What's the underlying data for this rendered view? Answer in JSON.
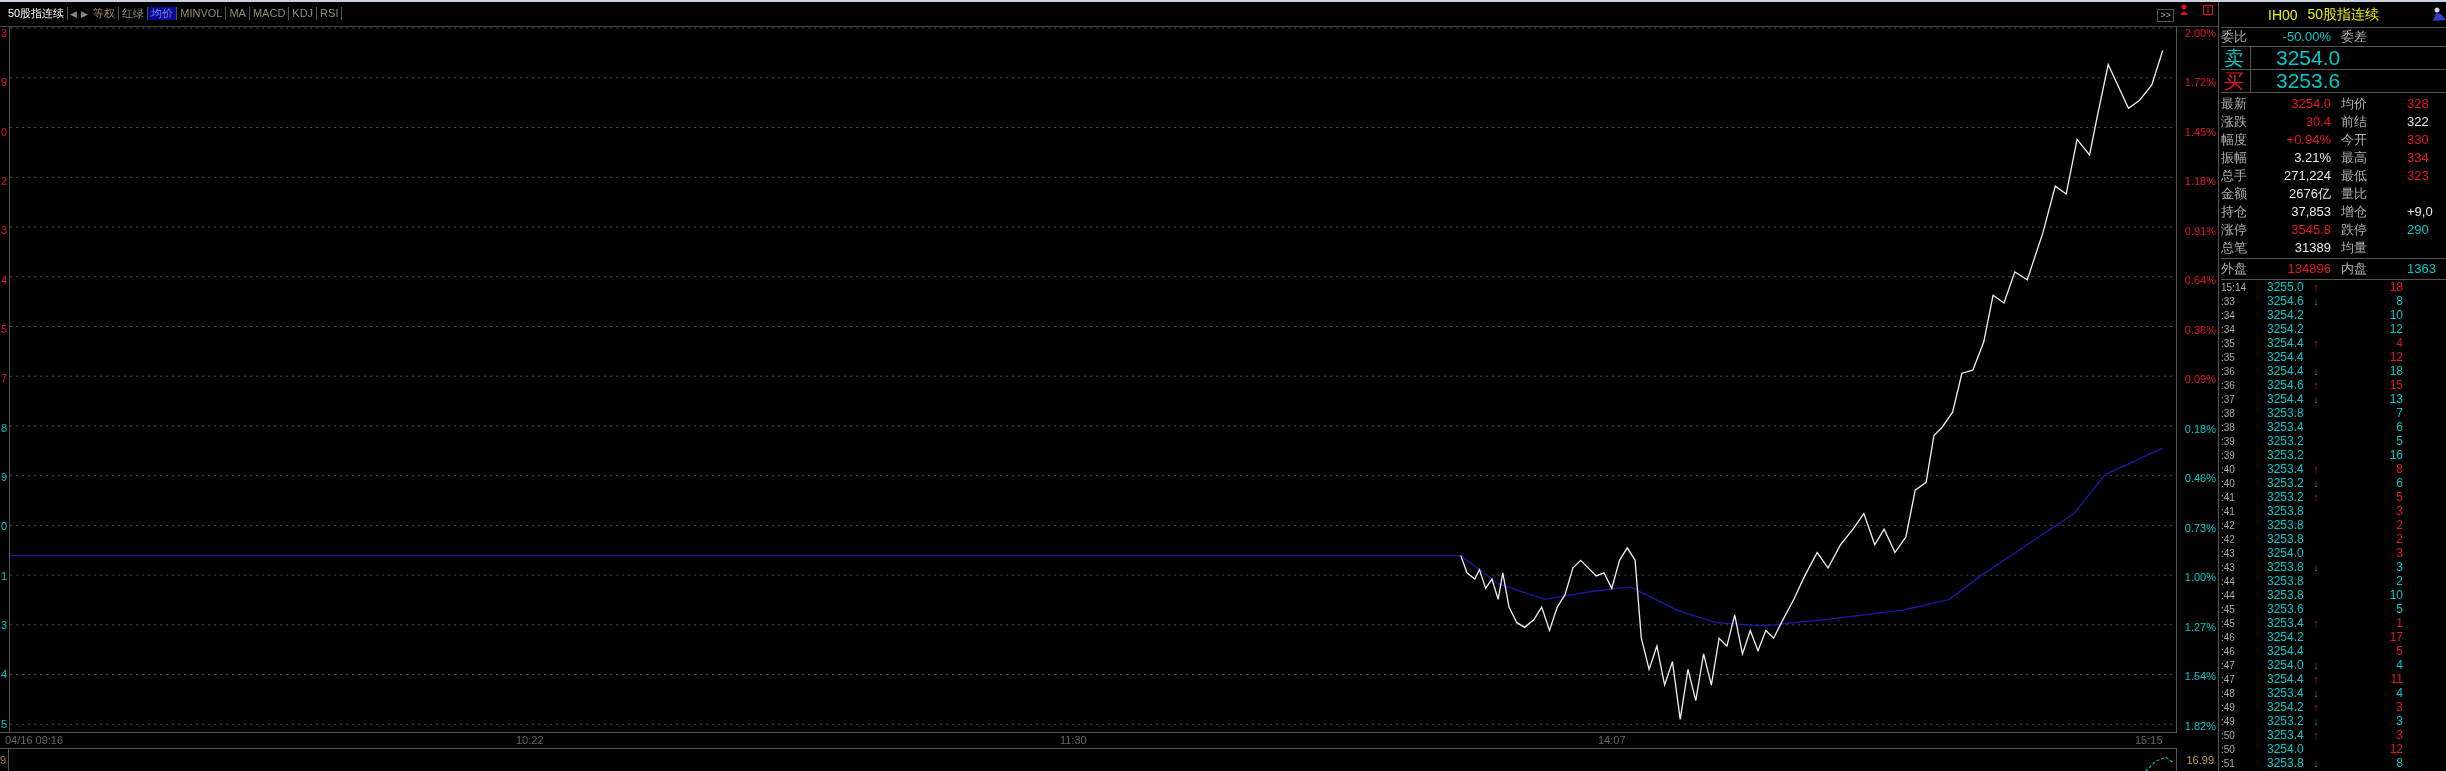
{
  "toolbar": {
    "title": "50股指连续",
    "nav": [
      "◀",
      "▶"
    ],
    "items": [
      {
        "label": "等权",
        "selected": false
      },
      {
        "label": "红绿",
        "selected": false
      },
      {
        "label": "均价",
        "selected": true
      },
      {
        "label": "MINVOL",
        "selected": false
      },
      {
        "label": "MA",
        "selected": false
      },
      {
        "label": "MACD",
        "selected": false
      },
      {
        "label": "KDJ",
        "selected": false
      },
      {
        "label": "RSI",
        "selected": false
      }
    ]
  },
  "chart": {
    "expand_button": ">>",
    "left_axis": [
      {
        "text": "3",
        "kind": "rise"
      },
      {
        "text": "9",
        "kind": "rise"
      },
      {
        "text": "0",
        "kind": "rise"
      },
      {
        "text": "2",
        "kind": "rise"
      },
      {
        "text": "3",
        "kind": "rise"
      },
      {
        "text": "4",
        "kind": "rise"
      },
      {
        "text": "5",
        "kind": "rise"
      },
      {
        "text": "7",
        "kind": "rise"
      },
      {
        "text": "8",
        "kind": "fall"
      },
      {
        "text": "9",
        "kind": "fall"
      },
      {
        "text": "0",
        "kind": "fall"
      },
      {
        "text": "1",
        "kind": "fall"
      },
      {
        "text": "3",
        "kind": "fall"
      },
      {
        "text": "4",
        "kind": "fall"
      },
      {
        "text": "5",
        "kind": "fall"
      }
    ],
    "right_axis": [
      {
        "text": "2.00%",
        "kind": "rise"
      },
      {
        "text": "1.72%",
        "kind": "rise"
      },
      {
        "text": "1.45%",
        "kind": "rise"
      },
      {
        "text": "1.18%",
        "kind": "rise"
      },
      {
        "text": "0.91%",
        "kind": "rise"
      },
      {
        "text": "0.64%",
        "kind": "rise"
      },
      {
        "text": "0.36%",
        "kind": "rise"
      },
      {
        "text": "0.09%",
        "kind": "rise"
      },
      {
        "text": "0.18%",
        "kind": "fall"
      },
      {
        "text": "0.46%",
        "kind": "fall"
      },
      {
        "text": "0.73%",
        "kind": "fall"
      },
      {
        "text": "1.00%",
        "kind": "fall"
      },
      {
        "text": "1.27%",
        "kind": "fall"
      },
      {
        "text": "1.54%",
        "kind": "fall"
      },
      {
        "text": "1.82%",
        "kind": "fall"
      }
    ],
    "time_labels": [
      "04/16 09:16",
      "10:22",
      "11:30",
      "14:07",
      "15:15"
    ],
    "lower_pane": {
      "left_label": "9",
      "right_label": "16.99"
    }
  },
  "panel": {
    "code": "IH00",
    "name": "50股指连续",
    "ratio": {
      "label": "委比",
      "value": "-50.00%",
      "label2": "委差"
    },
    "quotes": [
      {
        "label": "卖",
        "color": "#00c8c8",
        "price": "3254.0"
      },
      {
        "label": "买",
        "color": "#e0182a",
        "price": "3253.6"
      }
    ],
    "stats": [
      {
        "left": {
          "label": "最新",
          "value": "3254.0",
          "kind": "rise"
        },
        "right": {
          "label": "均价",
          "value": "328",
          "kind": "rise"
        }
      },
      {
        "left": {
          "label": "涨跌",
          "value": "30.4",
          "kind": "rise"
        },
        "right": {
          "label": "前结",
          "value": "322",
          "kind": "flat"
        }
      },
      {
        "left": {
          "label": "幅度",
          "value": "+0.94%",
          "kind": "rise"
        },
        "right": {
          "label": "今开",
          "value": "330",
          "kind": "rise"
        }
      },
      {
        "left": {
          "label": "振幅",
          "value": "3.21%",
          "kind": "flat"
        },
        "right": {
          "label": "最高",
          "value": "334",
          "kind": "rise"
        }
      },
      {
        "left": {
          "label": "总手",
          "value": "271,224",
          "kind": "flat"
        },
        "right": {
          "label": "最低",
          "value": "323",
          "kind": "rise"
        }
      },
      {
        "left": {
          "label": "金额",
          "value": "2676亿",
          "kind": "flat"
        },
        "right": {
          "label": "量比"
        }
      },
      {
        "left": {
          "label": "持仓",
          "value": "37,853",
          "kind": "flat"
        },
        "right": {
          "label": "增仓",
          "value": "+9,0",
          "kind": "flat"
        }
      },
      {
        "left": {
          "label": "涨停",
          "value": "3545.8",
          "kind": "rise"
        },
        "right": {
          "label": "跌停",
          "value": "290",
          "kind": "fall"
        }
      },
      {
        "left": {
          "label": "总笔",
          "value": "31389",
          "kind": "flat"
        },
        "right": {
          "label": "均量"
        }
      }
    ],
    "outer": {
      "label": "外盘",
      "value": "134896",
      "label2": "内盘",
      "value2": "1363"
    },
    "ticks": [
      {
        "time": "15:14",
        "price": "3255.0",
        "arrow": {
          "glyph": "↑",
          "kind": "up"
        },
        "volume": "18",
        "color": "#e0182a"
      },
      {
        "time": ":33",
        "price": "3254.6",
        "arrow": {
          "glyph": "↓",
          "kind": "down"
        },
        "volume": "8",
        "color": "#00c8c8"
      },
      {
        "time": ":34",
        "price": "3254.2",
        "volume": "10",
        "color": "#00c8c8"
      },
      {
        "time": ":34",
        "price": "3254.2",
        "volume": "12",
        "color": "#00c8c8"
      },
      {
        "time": ":35",
        "price": "3254.4",
        "arrow": {
          "glyph": "↑",
          "kind": "up"
        },
        "volume": "4",
        "color": "#e0182a"
      },
      {
        "time": ":35",
        "price": "3254.4",
        "volume": "12",
        "color": "#e0182a"
      },
      {
        "time": ":36",
        "price": "3254.4",
        "arrow": {
          "glyph": "↓",
          "kind": "down"
        },
        "volume": "18",
        "color": "#00c8c8"
      },
      {
        "time": ":36",
        "price": "3254.6",
        "arrow": {
          "glyph": "↑",
          "kind": "up"
        },
        "volume": "15",
        "color": "#e0182a"
      },
      {
        "time": ":37",
        "price": "3254.4",
        "arrow": {
          "glyph": "↓",
          "kind": "down"
        },
        "volume": "13",
        "color": "#00c8c8"
      },
      {
        "time": ":38",
        "price": "3253.8",
        "volume": "7",
        "color": "#00c8c8"
      },
      {
        "time": ":38",
        "price": "3253.4",
        "volume": "6",
        "color": "#00c8c8"
      },
      {
        "time": ":39",
        "price": "3253.2",
        "volume": "5",
        "color": "#00c8c8"
      },
      {
        "time": ":39",
        "price": "3253.2",
        "volume": "16",
        "color": "#00c8c8"
      },
      {
        "time": ":40",
        "price": "3253.4",
        "arrow": {
          "glyph": "↑",
          "kind": "up"
        },
        "volume": "8",
        "color": "#e0182a"
      },
      {
        "time": ":40",
        "price": "3253.2",
        "arrow": {
          "glyph": "↓",
          "kind": "down"
        },
        "volume": "6",
        "color": "#00c8c8"
      },
      {
        "time": ":41",
        "price": "3253.2",
        "arrow": {
          "glyph": "↑",
          "kind": "up"
        },
        "volume": "5",
        "color": "#e0182a"
      },
      {
        "time": ":41",
        "price": "3253.8",
        "volume": "3",
        "color": "#e0182a"
      },
      {
        "time": ":42",
        "price": "3253.8",
        "volume": "2",
        "color": "#e0182a"
      },
      {
        "time": ":42",
        "price": "3253.8",
        "volume": "2",
        "color": "#e0182a"
      },
      {
        "time": ":43",
        "price": "3254.0",
        "volume": "3",
        "color": "#e0182a"
      },
      {
        "time": ":43",
        "price": "3253.8",
        "arrow": {
          "glyph": "↓",
          "kind": "down"
        },
        "volume": "3",
        "color": "#00c8c8"
      },
      {
        "time": ":44",
        "price": "3253.8",
        "volume": "2",
        "color": "#00c8c8"
      },
      {
        "time": ":44",
        "price": "3253.8",
        "volume": "10",
        "color": "#00c8c8"
      },
      {
        "time": ":45",
        "price": "3253.6",
        "volume": "5",
        "color": "#00c8c8"
      },
      {
        "time": ":45",
        "price": "3253.4",
        "arrow": {
          "glyph": "↑",
          "kind": "up"
        },
        "volume": "1",
        "color": "#e0182a"
      },
      {
        "time": ":46",
        "price": "3254.2",
        "volume": "17",
        "color": "#e0182a"
      },
      {
        "time": ":46",
        "price": "3254.4",
        "volume": "5",
        "color": "#e0182a"
      },
      {
        "time": ":47",
        "price": "3254.0",
        "arrow": {
          "glyph": "↓",
          "kind": "down"
        },
        "volume": "4",
        "color": "#00c8c8"
      },
      {
        "time": ":47",
        "price": "3254.4",
        "arrow": {
          "glyph": "↑",
          "kind": "up"
        },
        "volume": "11",
        "color": "#e0182a"
      },
      {
        "time": ":48",
        "price": "3253.4",
        "arrow": {
          "glyph": "↓",
          "kind": "down"
        },
        "volume": "4",
        "color": "#00c8c8"
      },
      {
        "time": ":49",
        "price": "3254.2",
        "arrow": {
          "glyph": "↑",
          "kind": "up"
        },
        "volume": "3",
        "color": "#e0182a"
      },
      {
        "time": ":49",
        "price": "3253.2",
        "arrow": {
          "glyph": "↓",
          "kind": "down"
        },
        "volume": "3",
        "color": "#00c8c8"
      },
      {
        "time": ":50",
        "price": "3253.4",
        "arrow": {
          "glyph": "↑",
          "kind": "up"
        },
        "volume": "3",
        "color": "#e0182a"
      },
      {
        "time": ":50",
        "price": "3254.0",
        "volume": "12",
        "color": "#e0182a"
      },
      {
        "time": ":51",
        "price": "3253.8",
        "arrow": {
          "glyph": "↓",
          "kind": "down"
        },
        "volume": "8",
        "color": "#00c8c8"
      }
    ]
  }
}
